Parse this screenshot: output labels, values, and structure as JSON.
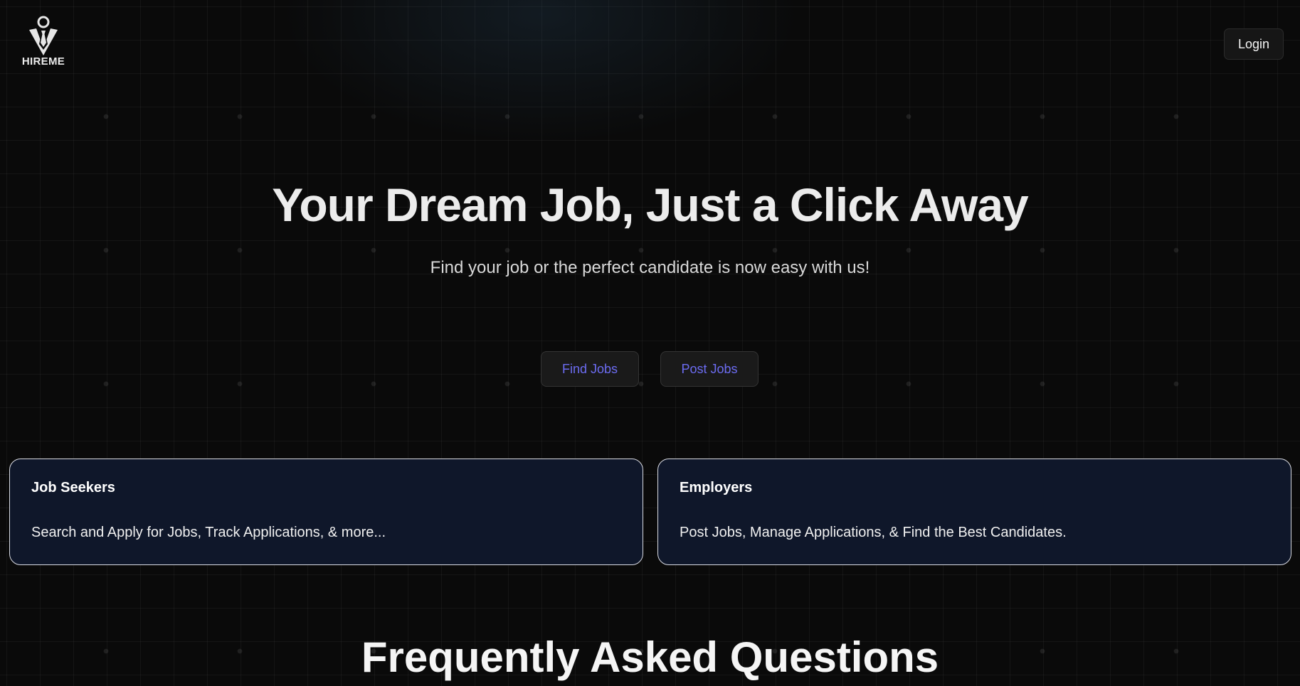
{
  "header": {
    "logo_text": "HIREME",
    "logo_icon": "tie-person-icon",
    "login_label": "Login"
  },
  "hero": {
    "title": "Your Dream Job, Just a Click Away",
    "subtitle": "Find your job or the perfect candidate is now easy with us!",
    "find_jobs_label": "Find Jobs",
    "post_jobs_label": "Post Jobs"
  },
  "cards": [
    {
      "title": "Job Seekers",
      "description": "Search and Apply for Jobs, Track Applications, & more..."
    },
    {
      "title": "Employers",
      "description": "Post Jobs, Manage Applications, & Find the Best Candidates."
    }
  ],
  "faq": {
    "title": "Frequently Asked Questions"
  },
  "colors": {
    "background": "#0a0a0a",
    "card_background": "#0f172a",
    "cta_text": "#6c6cf2",
    "card_border": "#d9dbe3"
  }
}
